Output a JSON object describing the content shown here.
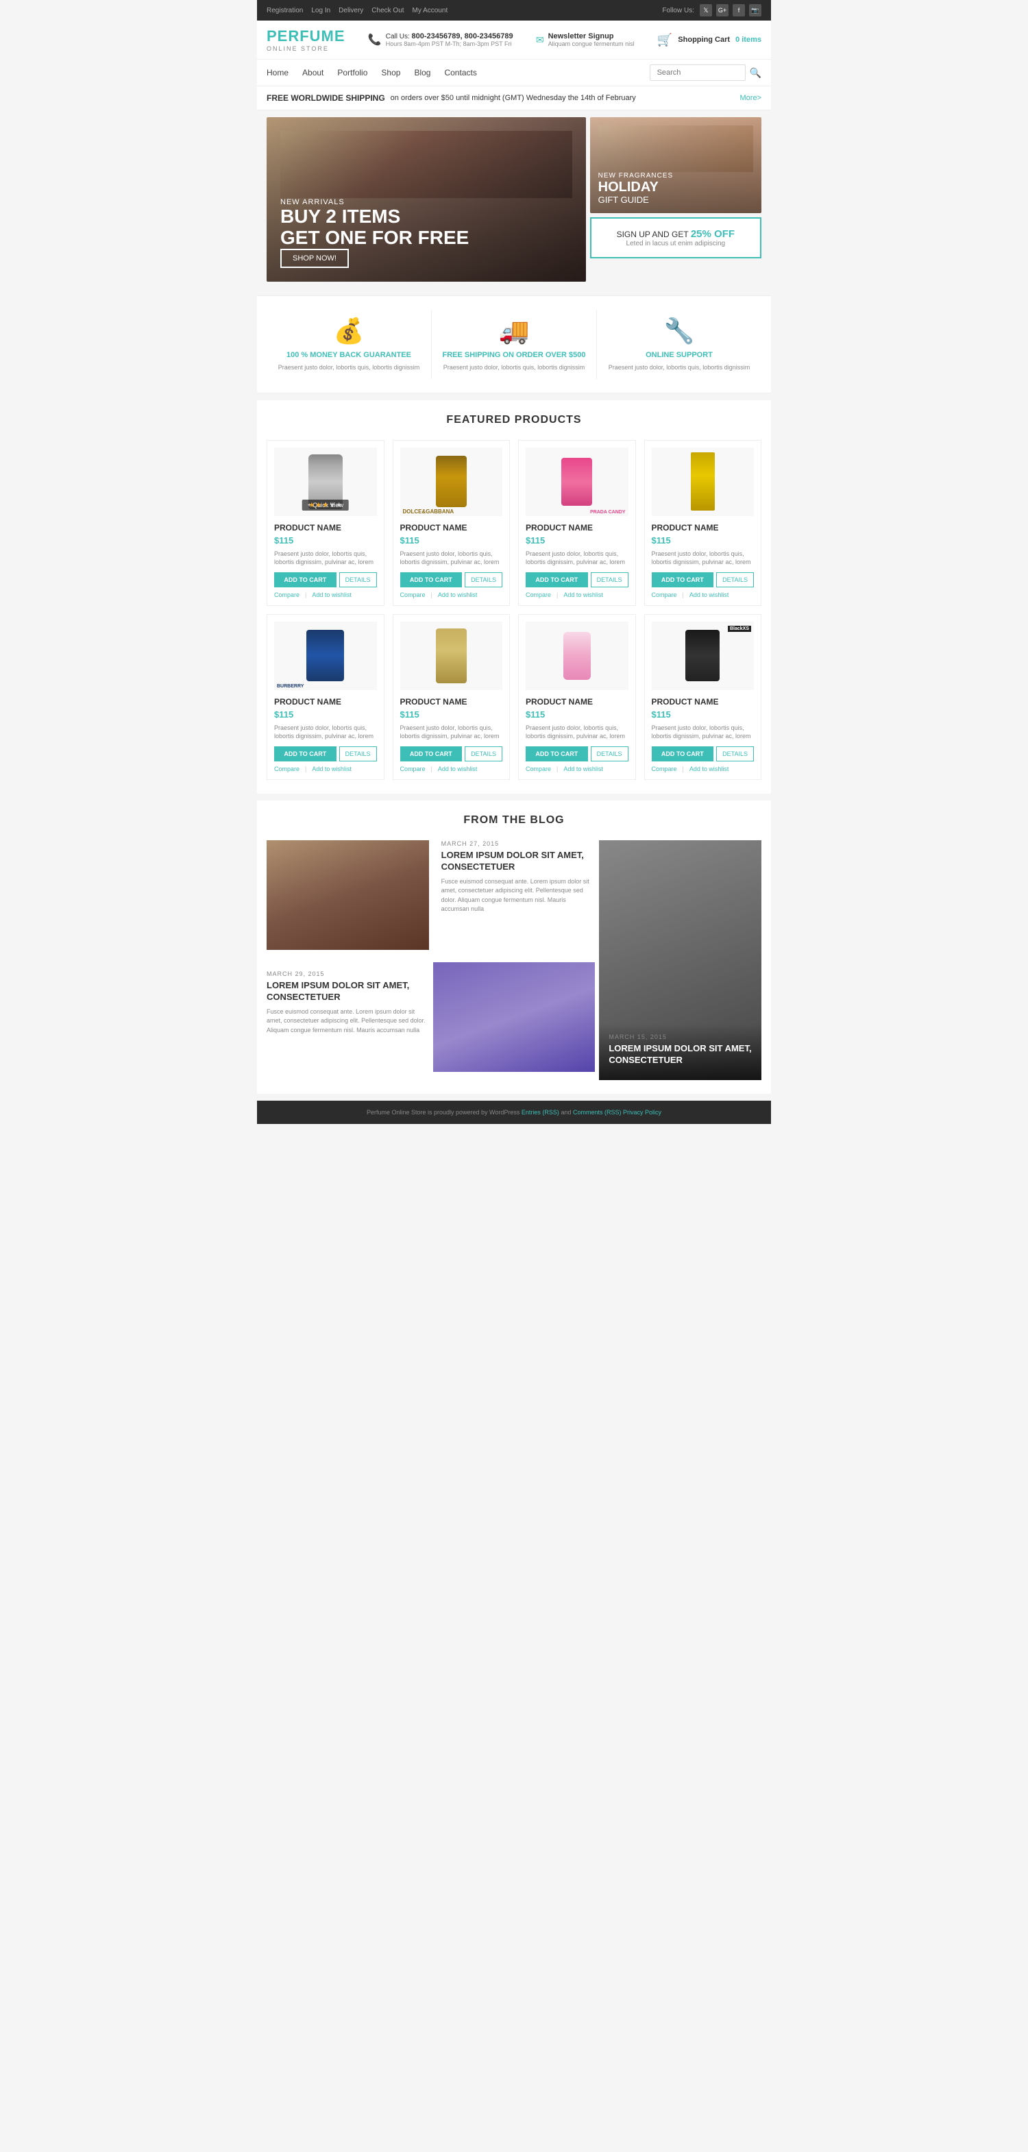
{
  "topbar": {
    "links": [
      "Registration",
      "Log In",
      "Delivery",
      "Check Out",
      "My Account"
    ],
    "follow_label": "Follow Us:",
    "social": [
      "twitter",
      "google-plus",
      "facebook",
      "instagram"
    ]
  },
  "header": {
    "logo_main": "PERFUME",
    "logo_sub": "ONLINE STORE",
    "phone_icon": "📞",
    "call_label": "Call Us:",
    "phone1": "800-23456789,",
    "phone2": "800-23456789",
    "hours": "Hours 8am-4pm PST M-Th; 8am-3pm PST Fri",
    "email_icon": "✉",
    "newsletter_label": "Newsletter Signup",
    "newsletter_sub": "Aliquam congue fermentum nisl",
    "cart_icon": "🛒",
    "cart_label": "Shopping Cart",
    "cart_count": "0 items"
  },
  "nav": {
    "links": [
      "Home",
      "About",
      "Portfolio",
      "Shop",
      "Blog",
      "Contacts"
    ],
    "search_placeholder": "Search"
  },
  "shipping_banner": {
    "label": "FREE WORLDWIDE SHIPPING",
    "text": " on orders over $50 until midnight (GMT) Wednesday  the 14th of February",
    "more": "More>"
  },
  "hero": {
    "tag": "NEW ARRIVALS",
    "title_line1": "BUY 2 ITEMS",
    "title_line2": "GET ONE FOR FREE",
    "btn": "SHOP NOW!",
    "holiday_tag": "NEW FRAGRANCES",
    "holiday_title": "HOLIDAY",
    "holiday_sub": "GIFT GUIDE",
    "signup_text": "SIGN UP AND GET",
    "signup_percent": "25% OFF",
    "signup_sub": "Leted in lacus ut enim adipiscing"
  },
  "features": [
    {
      "icon": "💰",
      "title": "100 % MONEY BACK GUARANTEE",
      "desc": "Praesent justo dolor, lobortis quis, lobortis dignissim"
    },
    {
      "icon": "🚚",
      "title": "FREE SHIPPING ON ORDER OVER $500",
      "desc": "Praesent justo dolor, lobortis quis, lobortis dignissim"
    },
    {
      "icon": "🔧",
      "title": "ONLINE SUPPORT",
      "desc": "Praesent justo dolor, lobortis quis, lobortis dignissim"
    }
  ],
  "featured": {
    "section_title": "FEATURED PRODUCTS",
    "products": [
      {
        "name": "PRODUCT NAME",
        "price": "$115",
        "desc": "Praesent justo dolor, lobortis quis, lobortis dignissim, pulvinar ac, lorem",
        "bottle": "1",
        "stars": 3,
        "has_quickview": true
      },
      {
        "name": "PRODUCT NAME",
        "price": "$115",
        "desc": "Praesent justo dolor, lobortis quis, lobortis dignissim, pulvinar ac, lorem",
        "bottle": "2",
        "stars": 0,
        "has_quickview": false
      },
      {
        "name": "PRODUCT NAME",
        "price": "$115",
        "desc": "Praesent justo dolor, lobortis quis, lobortis dignissim, pulvinar ac, lorem",
        "bottle": "3",
        "stars": 0,
        "has_quickview": false
      },
      {
        "name": "PRODUCT NAME",
        "price": "$115",
        "desc": "Praesent justo dolor, lobortis quis, lobortis dignissim, pulvinar ac, lorem",
        "bottle": "4",
        "stars": 0,
        "has_quickview": false
      },
      {
        "name": "PRODUCT NAME",
        "price": "$115",
        "desc": "Praesent justo dolor, lobortis quis, lobortis dignissim, pulvinar ac, lorem",
        "bottle": "5",
        "stars": 0,
        "has_quickview": false
      },
      {
        "name": "PRODUCT NAME",
        "price": "$115",
        "desc": "Praesent justo dolor, lobortis quis, lobortis dignissim, pulvinar ac, lorem",
        "bottle": "6",
        "stars": 0,
        "has_quickview": false
      },
      {
        "name": "PRODUCT NAME",
        "price": "$115",
        "desc": "Praesent justo dolor, lobortis quis, lobortis dignissim, pulvinar ac, lorem",
        "bottle": "7",
        "stars": 0,
        "has_quickview": false
      },
      {
        "name": "PRODUCT NAME",
        "price": "$115",
        "desc": "Praesent justo dolor, lobortis quis, lobortis dignissim, pulvinar ac, lorem",
        "bottle": "8",
        "stars": 0,
        "has_quickview": false
      }
    ],
    "btn_cart": "ADD TO CART",
    "btn_details": "DETAILS",
    "compare": "Compare",
    "wishlist": "Add to wishlist"
  },
  "blog": {
    "section_title": "FROM THE BLOG",
    "posts": [
      {
        "date": "MARCH 27, 2015",
        "title": "LOREM IPSUM DOLOR SIT AMET, CONSECTETUER",
        "text": "Fusce euismod consequat ante. Lorem ipsum dolor sit amet, consectetuer adipiscing elit. Pellentesque sed dolor. Aliquam congue fermentum nisl. Mauris accumsan nulla"
      },
      {
        "date": "MARCH 29, 2015",
        "title": "LOREM IPSUM DOLOR SIT AMET, CONSECTETUER",
        "text": "Fusce euismod consequat ante. Lorem ipsum dolor sit amet, consectetuer adipiscing elit. Pellentesque sed dolor. Aliquam congue fermentum nisl. Mauris accumsan nulla"
      },
      {
        "date": "MARCH 15, 2015",
        "title": "LOREM IPSUM DOLOR SIT AMET, CONSECTETUER",
        "text": ""
      }
    ]
  },
  "footer": {
    "text": "Perfume Online Store is proudly powered by WordPress",
    "links": [
      "Entries (RSS)",
      "Comments (RSS)",
      "Privacy Policy"
    ]
  }
}
